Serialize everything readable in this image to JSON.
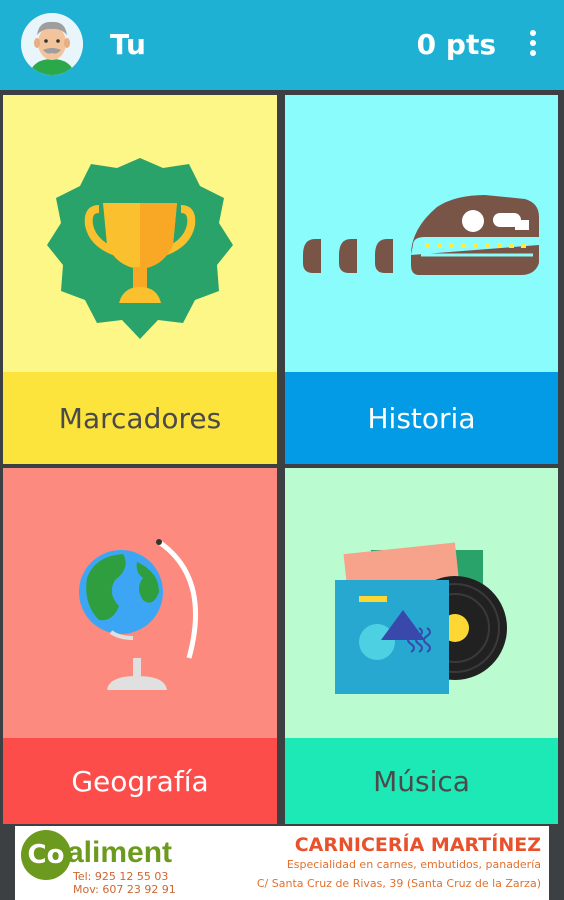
{
  "header": {
    "title": "Tu",
    "points": "0 pts",
    "avatar_icon": "grandpa-avatar",
    "menu_icon": "more-vert-icon"
  },
  "categories": [
    {
      "label": "Marcadores",
      "icon": "trophy-icon",
      "bg": "#fcf787",
      "band": "#fde43c"
    },
    {
      "label": "Historia",
      "icon": "dinosaur-skull-icon",
      "bg": "#8bfcfc",
      "band": "#039be5"
    },
    {
      "label": "Geografía",
      "icon": "globe-icon",
      "bg": "#fc8a7e",
      "band": "#fc4d4a"
    },
    {
      "label": "Música",
      "icon": "vinyl-record-icon",
      "bg": "#bafcd0",
      "band": "#1de9b6"
    }
  ],
  "ad": {
    "logo_text": "Co",
    "brand": "aliment",
    "phone1": "Tel: 925 12 55 03",
    "phone2": "Mov: 607 23 92 91",
    "shop_name": "CARNICERÍA MARTÍNEZ",
    "description": "Especialidad en carnes, embutidos, panadería",
    "address": "C/ Santa Cruz de Rivas, 39 (Santa Cruz de la Zarza)"
  }
}
